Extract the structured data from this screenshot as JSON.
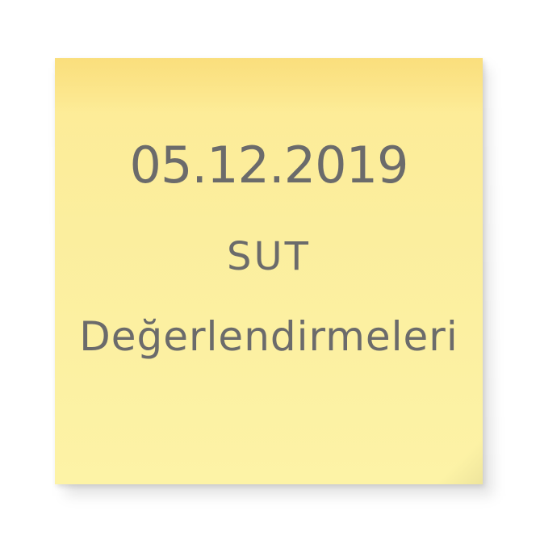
{
  "note": {
    "line1": "05.12.2019",
    "line2": "SUT",
    "line3": "Değerlendirmeleri"
  },
  "colors": {
    "note_background": "#fdee9e",
    "text": "#6b6b6b"
  }
}
